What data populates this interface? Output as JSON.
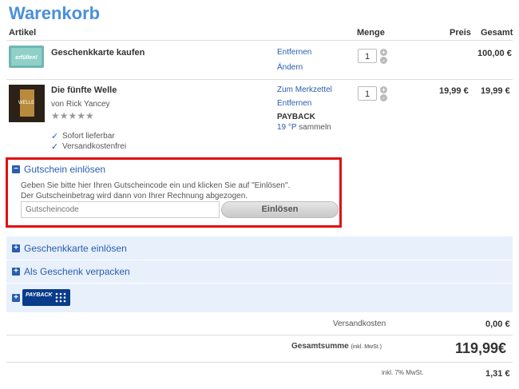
{
  "page": {
    "title": "Warenkorb"
  },
  "table_headers": {
    "artikel": "Artikel",
    "menge": "Menge",
    "preis": "Preis",
    "gesamt": "Gesamt"
  },
  "items": [
    {
      "title": "Geschenkkarte kaufen",
      "actions": [
        "Entfernen",
        "Ändern"
      ],
      "quantity": "1",
      "price": "",
      "total": "100,00 €"
    },
    {
      "title": "Die fünfte Welle",
      "author": "von Rick Yancey",
      "rating_stars": "★★★★★",
      "rating_value": 0,
      "actions": [
        "Zum Merkzettel",
        "Entfernen"
      ],
      "payback_label": "PAYBACK",
      "payback_points": "19 °P",
      "payback_suffix": "sammeln",
      "quantity": "1",
      "price": "19,99 €",
      "total": "19,99 €",
      "features": [
        "Sofort lieferbar",
        "Versandkostenfrei"
      ]
    }
  ],
  "voucher": {
    "toggle_label": "Gutschein einlösen",
    "description_line1": "Geben Sie bitte hier Ihren Gutscheincode ein und klicken Sie auf \"Einlösen\".",
    "description_line2": "Der Gutscheinbetrag wird dann von Ihrer Rechnung abgezogen.",
    "placeholder": "Gutscheincode",
    "button_label": "Einlösen"
  },
  "panels": {
    "gift_card": "Geschenkkarte einlösen",
    "gift_wrap": "Als Geschenk verpacken",
    "payback_logo_text": "PAYBACK"
  },
  "summary": {
    "shipping_label": "Versandkosten",
    "shipping_value": "0,00 €",
    "total_label": "Gesamtsumme",
    "total_note": "(inkl. MwSt.)",
    "total_value": "119,99€",
    "vat_label": "inkl. 7% MwSt.",
    "vat_value": "1,31 €"
  },
  "colors": {
    "accent": "#4a90d9",
    "link": "#2a5db0",
    "highlight_border": "#e01010",
    "panel_bg": "#e8f0fb"
  }
}
